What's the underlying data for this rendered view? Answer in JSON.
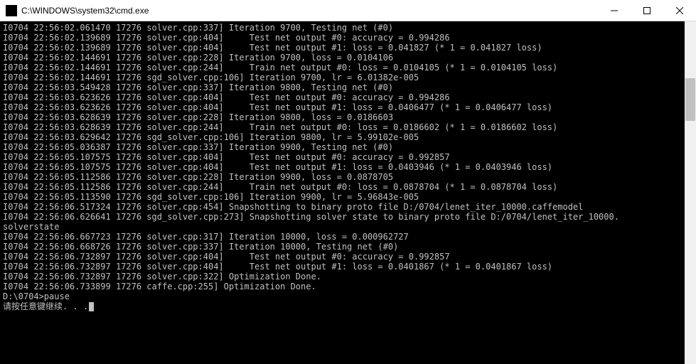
{
  "window": {
    "title": "C:\\WINDOWS\\system32\\cmd.exe"
  },
  "lines": [
    "I0704 22:56:02.061470 17276 solver.cpp:337] Iteration 9700, Testing net (#0)",
    "I0704 22:56:02.139689 17276 solver.cpp:404]     Test net output #0: accuracy = 0.994286",
    "I0704 22:56:02.139689 17276 solver.cpp:404]     Test net output #1: loss = 0.041827 (* 1 = 0.041827 loss)",
    "I0704 22:56:02.144691 17276 solver.cpp:228] Iteration 9700, loss = 0.0104106",
    "I0704 22:56:02.144691 17276 solver.cpp:244]     Train net output #0: loss = 0.0104105 (* 1 = 0.0104105 loss)",
    "I0704 22:56:02.144691 17276 sgd_solver.cpp:106] Iteration 9700, lr = 6.01382e-005",
    "I0704 22:56:03.549428 17276 solver.cpp:337] Iteration 9800, Testing net (#0)",
    "I0704 22:56:03.623626 17276 solver.cpp:404]     Test net output #0: accuracy = 0.994286",
    "I0704 22:56:03.623626 17276 solver.cpp:404]     Test net output #1: loss = 0.0406477 (* 1 = 0.0406477 loss)",
    "I0704 22:56:03.628639 17276 solver.cpp:228] Iteration 9800, loss = 0.0186603",
    "I0704 22:56:03.628639 17276 solver.cpp:244]     Train net output #0: loss = 0.0186602 (* 1 = 0.0186602 loss)",
    "I0704 22:56:03.629642 17276 sgd_solver.cpp:106] Iteration 9800, lr = 5.99102e-005",
    "I0704 22:56:05.036387 17276 solver.cpp:337] Iteration 9900, Testing net (#0)",
    "I0704 22:56:05.107575 17276 solver.cpp:404]     Test net output #0: accuracy = 0.992857",
    "I0704 22:56:05.107575 17276 solver.cpp:404]     Test net output #1: loss = 0.0403946 (* 1 = 0.0403946 loss)",
    "I0704 22:56:05.112586 17276 solver.cpp:228] Iteration 9900, loss = 0.0878705",
    "I0704 22:56:05.112586 17276 solver.cpp:244]     Train net output #0: loss = 0.0878704 (* 1 = 0.0878704 loss)",
    "I0704 22:56:05.113590 17276 sgd_solver.cpp:106] Iteration 9900, lr = 5.96843e-005",
    "I0704 22:56:06.517324 17276 solver.cpp:454] Snapshotting to binary proto file D:/0704/lenet_iter_10000.caffemodel",
    "I0704 22:56:06.626641 17276 sgd_solver.cpp:273] Snapshotting solver state to binary proto file D:/0704/lenet_iter_10000.",
    "solverstate",
    "I0704 22:56:06.667723 17276 solver.cpp:317] Iteration 10000, loss = 0.000962727",
    "I0704 22:56:06.668726 17276 solver.cpp:337] Iteration 10000, Testing net (#0)",
    "I0704 22:56:06.732897 17276 solver.cpp:404]     Test net output #0: accuracy = 0.992857",
    "I0704 22:56:06.732897 17276 solver.cpp:404]     Test net output #1: loss = 0.0401867 (* 1 = 0.0401867 loss)",
    "I0704 22:56:06.732897 17276 solver.cpp:322] Optimization Done.",
    "I0704 22:56:06.733899 17276 caffe.cpp:255] Optimization Done.",
    "",
    "D:\\0704>pause",
    "请按任意键继续. . ."
  ]
}
